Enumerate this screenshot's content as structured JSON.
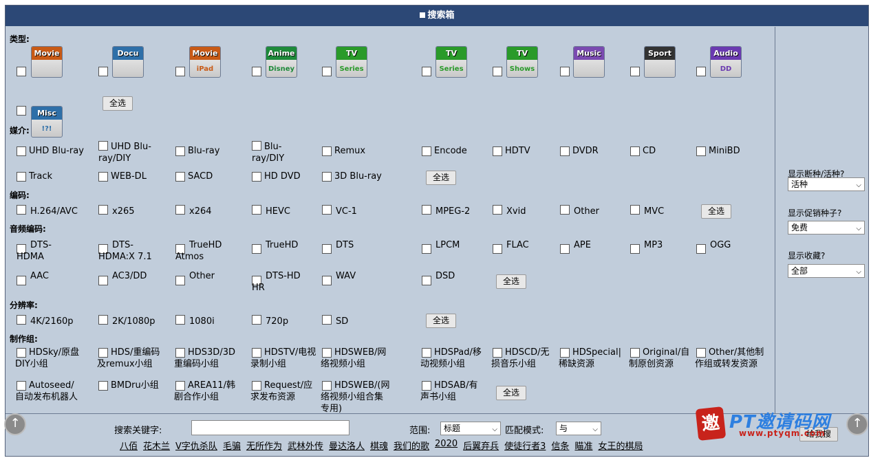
{
  "header": {
    "title": "搜索箱"
  },
  "sections": {
    "type": "类型:",
    "medium": "媒介:",
    "codec": "编码:",
    "audio": "音频编码:",
    "resolution": "分辨率:",
    "team": "制作组:"
  },
  "categories": [
    {
      "top": "Movie",
      "bottom": "",
      "color": "#c85a16"
    },
    {
      "top": "Docu",
      "bottom": "",
      "color": "#2e6fa8"
    },
    {
      "top": "Movie",
      "bottom": "iPad",
      "color": "#c85a16"
    },
    {
      "top": "Anime",
      "bottom": "Disney",
      "color": "#1e8a3a"
    },
    {
      "top": "TV",
      "bottom": "Series",
      "color": "#2a9a2a"
    },
    {
      "top": "TV",
      "bottom": "Series",
      "color": "#2a9a2a"
    },
    {
      "top": "TV",
      "bottom": "Shows",
      "color": "#2a9a2a"
    },
    {
      "top": "Music",
      "bottom": "",
      "color": "#7a4ab0"
    },
    {
      "top": "Sport",
      "bottom": "",
      "color": "#333333"
    },
    {
      "top": "Audio",
      "bottom": "DD",
      "color": "#6a3ab0"
    },
    {
      "top": "Misc",
      "bottom": "!?!",
      "color": "#2e6fa8"
    }
  ],
  "select_all": "全选",
  "medium": [
    "UHD Blu-ray",
    "UHD Blu-ray/DIY",
    "Blu-ray",
    "Blu-ray/DIY",
    "Remux",
    "Encode",
    "HDTV",
    "DVDR",
    "CD",
    "MiniBD",
    "Track",
    "WEB-DL",
    "SACD",
    "HD DVD",
    "3D Blu-ray"
  ],
  "codec": [
    "H.264/AVC",
    "x265",
    "x264",
    "HEVC",
    "VC-1",
    "MPEG-2",
    "Xvid",
    "Other",
    "MVC"
  ],
  "audio": [
    "DTS-HDMA",
    "DTS-HDMA:X 7.1",
    "TrueHD Atmos",
    "TrueHD",
    "DTS",
    "LPCM",
    "FLAC",
    "APE",
    "MP3",
    "OGG",
    "AAC",
    "AC3/DD",
    "Other",
    "DTS-HD HR",
    "WAV",
    "DSD"
  ],
  "resolution": [
    "4K/2160p",
    "2K/1080p",
    "1080i",
    "720p",
    "SD"
  ],
  "team": [
    "HDSky/原盘DIY小组",
    "HDS/重编码及remux小组",
    "HDS3D/3D重编码小组",
    "HDSTV/电视录制小组",
    "HDSWEB/网络视频小组",
    "HDSPad/移动视频小组",
    "HDSCD/无损音乐小组",
    "HDSpecial|稀缺资源",
    "Original/自制原创资源",
    "Other/其他制作组或转发资源",
    "Autoseed/自动发布机器人",
    "BMDru小组",
    "AREA11/韩剧合作小组",
    "Request/应求发布资源",
    "HDSWEB/(网络视频小组合集专用)",
    "HDSAB/有声书小组"
  ],
  "side": {
    "dead_label": "显示断种/活种?",
    "dead_value": "活种",
    "promo_label": "显示促销种子?",
    "promo_value": "免费",
    "fav_label": "显示收藏?",
    "fav_value": "全部"
  },
  "search": {
    "keyword_label": "搜索关键字:",
    "scope_label": "范围:",
    "scope_value": "标题",
    "match_label": "匹配模式:",
    "match_value": "与",
    "submit": "给我搜"
  },
  "hot_keywords": [
    "八佰",
    "花木兰",
    "V字仇杀队",
    "毛骗",
    "无所作为",
    "武林外传",
    "曼达洛人",
    "棋魂",
    "我们的歌",
    "2020",
    "后翼弃兵",
    "使徒行者3",
    "信条",
    "瞄准",
    "女王的棋局"
  ],
  "watermark": {
    "brand": "PT邀请码网",
    "url": "www.ptyqm.com"
  }
}
